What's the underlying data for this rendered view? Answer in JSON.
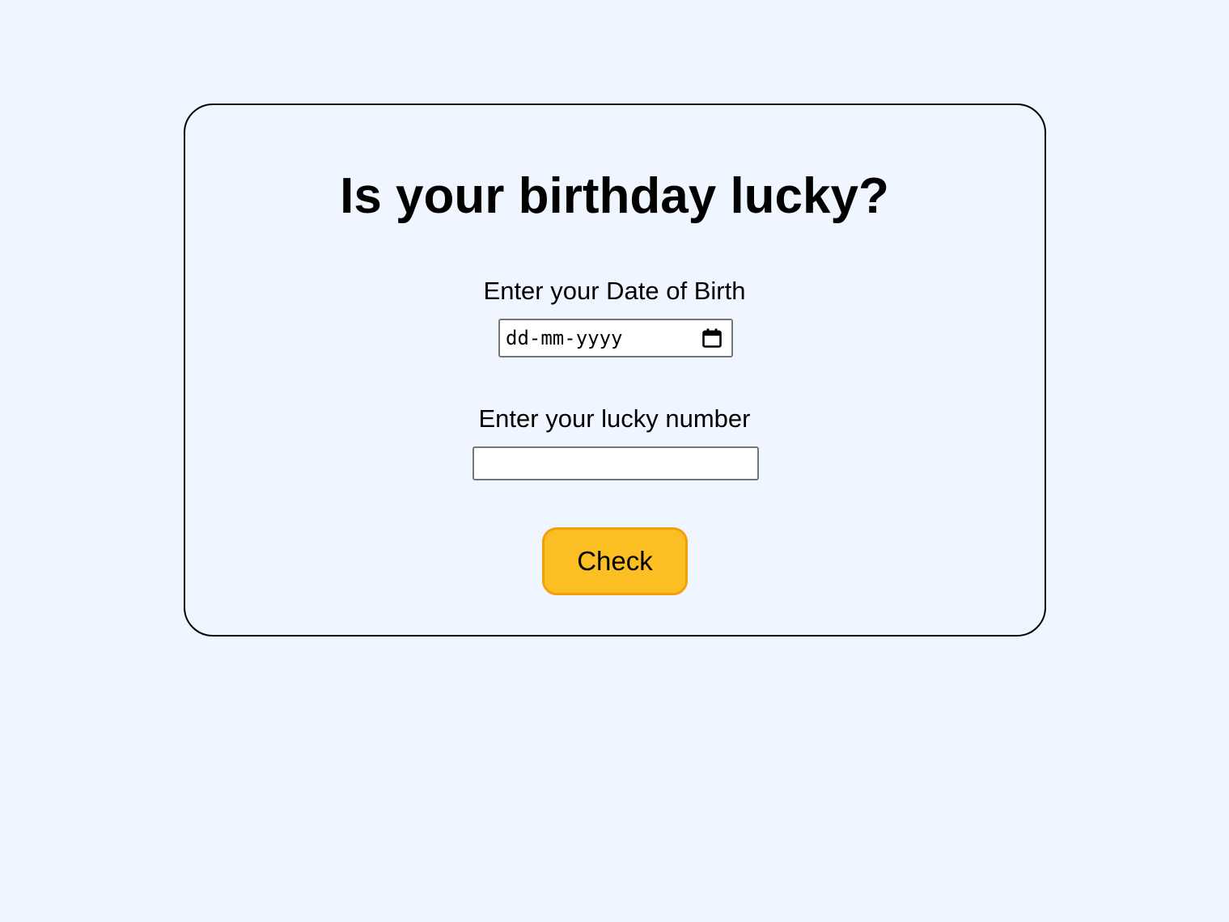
{
  "page": {
    "background_color": "#eff6ff"
  },
  "card": {
    "title": "Is your birthday lucky?",
    "dob": {
      "label": "Enter your Date of Birth",
      "placeholder": "dd-mm-yyyy",
      "icon": "calendar-icon"
    },
    "lucky_number": {
      "label": "Enter your lucky number",
      "value": ""
    },
    "check_button": {
      "label": "Check",
      "color": "#fbbf24",
      "border_color": "#f59e0b"
    }
  }
}
